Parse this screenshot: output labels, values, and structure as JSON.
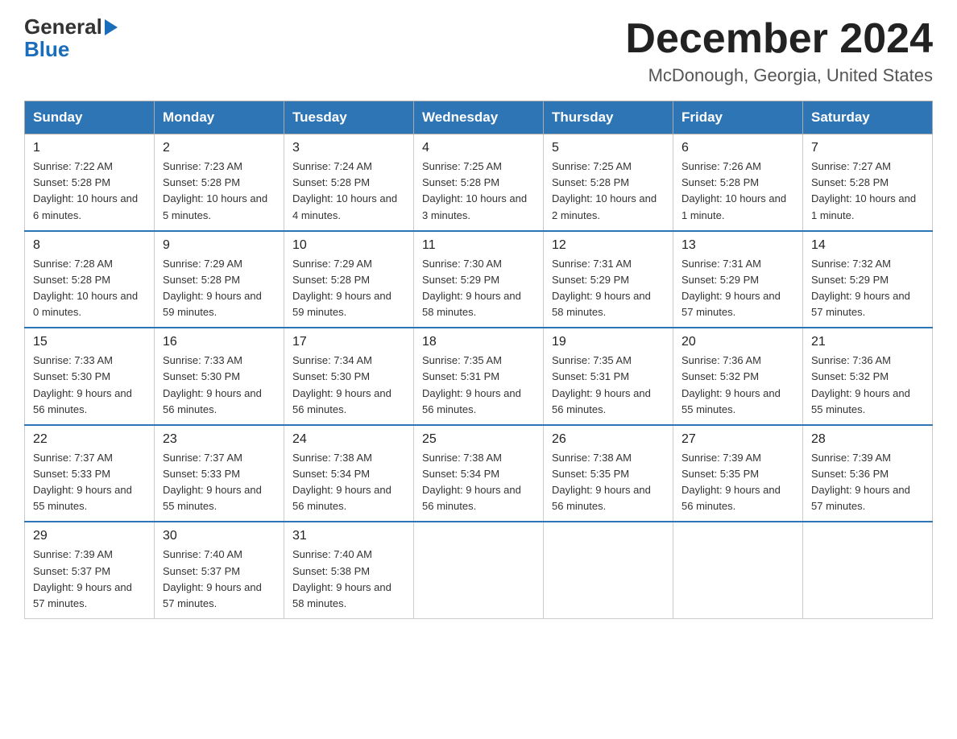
{
  "logo": {
    "line1": "General",
    "line2": "Blue"
  },
  "header": {
    "title": "December 2024",
    "subtitle": "McDonough, Georgia, United States"
  },
  "weekdays": [
    "Sunday",
    "Monday",
    "Tuesday",
    "Wednesday",
    "Thursday",
    "Friday",
    "Saturday"
  ],
  "weeks": [
    [
      {
        "day": "1",
        "sunrise": "7:22 AM",
        "sunset": "5:28 PM",
        "daylight": "10 hours and 6 minutes."
      },
      {
        "day": "2",
        "sunrise": "7:23 AM",
        "sunset": "5:28 PM",
        "daylight": "10 hours and 5 minutes."
      },
      {
        "day": "3",
        "sunrise": "7:24 AM",
        "sunset": "5:28 PM",
        "daylight": "10 hours and 4 minutes."
      },
      {
        "day": "4",
        "sunrise": "7:25 AM",
        "sunset": "5:28 PM",
        "daylight": "10 hours and 3 minutes."
      },
      {
        "day": "5",
        "sunrise": "7:25 AM",
        "sunset": "5:28 PM",
        "daylight": "10 hours and 2 minutes."
      },
      {
        "day": "6",
        "sunrise": "7:26 AM",
        "sunset": "5:28 PM",
        "daylight": "10 hours and 1 minute."
      },
      {
        "day": "7",
        "sunrise": "7:27 AM",
        "sunset": "5:28 PM",
        "daylight": "10 hours and 1 minute."
      }
    ],
    [
      {
        "day": "8",
        "sunrise": "7:28 AM",
        "sunset": "5:28 PM",
        "daylight": "10 hours and 0 minutes."
      },
      {
        "day": "9",
        "sunrise": "7:29 AM",
        "sunset": "5:28 PM",
        "daylight": "9 hours and 59 minutes."
      },
      {
        "day": "10",
        "sunrise": "7:29 AM",
        "sunset": "5:28 PM",
        "daylight": "9 hours and 59 minutes."
      },
      {
        "day": "11",
        "sunrise": "7:30 AM",
        "sunset": "5:29 PM",
        "daylight": "9 hours and 58 minutes."
      },
      {
        "day": "12",
        "sunrise": "7:31 AM",
        "sunset": "5:29 PM",
        "daylight": "9 hours and 58 minutes."
      },
      {
        "day": "13",
        "sunrise": "7:31 AM",
        "sunset": "5:29 PM",
        "daylight": "9 hours and 57 minutes."
      },
      {
        "day": "14",
        "sunrise": "7:32 AM",
        "sunset": "5:29 PM",
        "daylight": "9 hours and 57 minutes."
      }
    ],
    [
      {
        "day": "15",
        "sunrise": "7:33 AM",
        "sunset": "5:30 PM",
        "daylight": "9 hours and 56 minutes."
      },
      {
        "day": "16",
        "sunrise": "7:33 AM",
        "sunset": "5:30 PM",
        "daylight": "9 hours and 56 minutes."
      },
      {
        "day": "17",
        "sunrise": "7:34 AM",
        "sunset": "5:30 PM",
        "daylight": "9 hours and 56 minutes."
      },
      {
        "day": "18",
        "sunrise": "7:35 AM",
        "sunset": "5:31 PM",
        "daylight": "9 hours and 56 minutes."
      },
      {
        "day": "19",
        "sunrise": "7:35 AM",
        "sunset": "5:31 PM",
        "daylight": "9 hours and 56 minutes."
      },
      {
        "day": "20",
        "sunrise": "7:36 AM",
        "sunset": "5:32 PM",
        "daylight": "9 hours and 55 minutes."
      },
      {
        "day": "21",
        "sunrise": "7:36 AM",
        "sunset": "5:32 PM",
        "daylight": "9 hours and 55 minutes."
      }
    ],
    [
      {
        "day": "22",
        "sunrise": "7:37 AM",
        "sunset": "5:33 PM",
        "daylight": "9 hours and 55 minutes."
      },
      {
        "day": "23",
        "sunrise": "7:37 AM",
        "sunset": "5:33 PM",
        "daylight": "9 hours and 55 minutes."
      },
      {
        "day": "24",
        "sunrise": "7:38 AM",
        "sunset": "5:34 PM",
        "daylight": "9 hours and 56 minutes."
      },
      {
        "day": "25",
        "sunrise": "7:38 AM",
        "sunset": "5:34 PM",
        "daylight": "9 hours and 56 minutes."
      },
      {
        "day": "26",
        "sunrise": "7:38 AM",
        "sunset": "5:35 PM",
        "daylight": "9 hours and 56 minutes."
      },
      {
        "day": "27",
        "sunrise": "7:39 AM",
        "sunset": "5:35 PM",
        "daylight": "9 hours and 56 minutes."
      },
      {
        "day": "28",
        "sunrise": "7:39 AM",
        "sunset": "5:36 PM",
        "daylight": "9 hours and 57 minutes."
      }
    ],
    [
      {
        "day": "29",
        "sunrise": "7:39 AM",
        "sunset": "5:37 PM",
        "daylight": "9 hours and 57 minutes."
      },
      {
        "day": "30",
        "sunrise": "7:40 AM",
        "sunset": "5:37 PM",
        "daylight": "9 hours and 57 minutes."
      },
      {
        "day": "31",
        "sunrise": "7:40 AM",
        "sunset": "5:38 PM",
        "daylight": "9 hours and 58 minutes."
      },
      null,
      null,
      null,
      null
    ]
  ]
}
